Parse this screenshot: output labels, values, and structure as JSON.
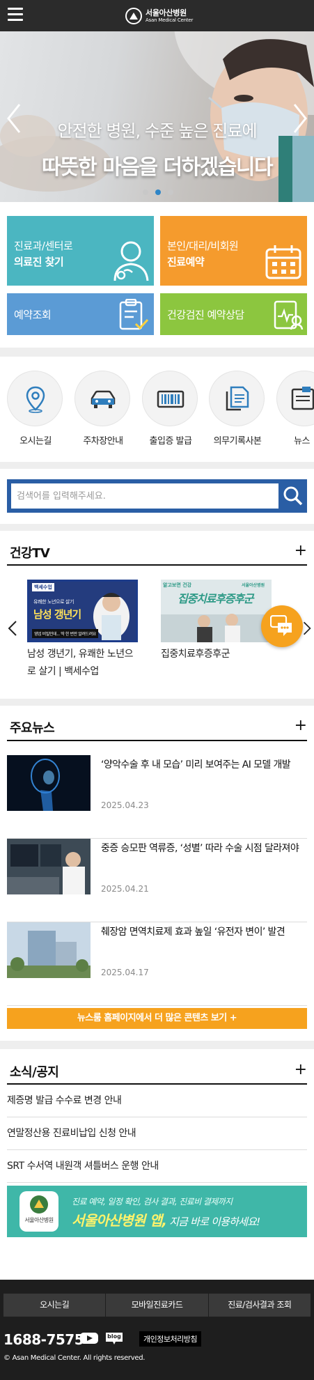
{
  "header": {
    "logo_ko": "서울아산병원",
    "logo_en": "Asan Medical Center"
  },
  "banner": {
    "line1": "안전한 병원, 수준 높은 진료에",
    "line2": "따뜻한 마음을 더하겠습니다",
    "slide_count": 3,
    "active_slide": 2
  },
  "tiles": {
    "find_doctor": {
      "line1": "진료과/센터로",
      "line2": "의료진 찾기",
      "color": "#4bb6c1"
    },
    "reservation": {
      "line1": "본인/대리/비회원",
      "line2": "진료예약",
      "color": "#f59b2d"
    },
    "check_reservation": {
      "label": "예약조회",
      "color": "#5b9bd5"
    },
    "checkup": {
      "label": "건강검진 예약상담",
      "color": "#8cc63f"
    }
  },
  "shortcuts": [
    {
      "label": "오시는길",
      "icon": "map-pin-icon"
    },
    {
      "label": "주차장안내",
      "icon": "car-icon"
    },
    {
      "label": "출입증 발급",
      "icon": "barcode-icon"
    },
    {
      "label": "의무기록사본",
      "icon": "documents-icon"
    },
    {
      "label": "뉴스",
      "icon": "news-icon"
    }
  ],
  "search": {
    "placeholder": "검색어를 입력해주세요."
  },
  "health_tv": {
    "title": "건강TV",
    "plus": "+",
    "items": [
      {
        "caption_line1": "남성 갱년기, 유쾌한 노년으",
        "caption_line2": "로 살기 | 백세수업",
        "thumb_badge": "백세수업",
        "thumb_small": "유쾌한 노년으로 살기",
        "thumb_big": "남성 갱년기",
        "thumb_bottom": "영업 비밀인데... 딱 한 번만 알려드려요"
      },
      {
        "caption_line1": "집중치료후증후군",
        "thumb_title": "집중치료후증후군",
        "thumb_badge": "알고보면 건강",
        "thumb_logo": "서울아산병원"
      }
    ]
  },
  "news": {
    "title": "주요뉴스",
    "plus": "+",
    "items": [
      {
        "title": "‘양악수술 후 내 모습’ 미리 보여주는 AI 모델 개발",
        "date": "2025.04.23"
      },
      {
        "title": "중증 승모판 역류증, ‘성별’ 따라 수술 시점 달라져야",
        "date": "2025.04.21"
      },
      {
        "title": "췌장암 면역치료제 효과 높일 ‘유전자 변이’ 발견",
        "date": "2025.04.17"
      }
    ],
    "more": "뉴스룸 홈페이지에서 더 많은 콘텐츠 보기 +"
  },
  "notices": {
    "title": "소식/공지",
    "plus": "+",
    "items": [
      "제증명 발급 수수료 변경 안내",
      "연말정산용 진료비납입 신청 안내",
      "SRT 수서역 내원객 셔틀버스 운행 안내"
    ]
  },
  "app_banner": {
    "sub": "진료 예약, 일정 확인, 검사 결과, 진료비 결제까지",
    "main_bold": "서울아산병원 앱,",
    "main_rest": " 지금 바로 이용하세요!",
    "logo_text": "서울아산병원"
  },
  "footer": {
    "nav": [
      "오시는길",
      "모바일진료카드",
      "진료/검사결과 조회"
    ],
    "phone": "1688-7575",
    "blog": "blog",
    "privacy": "개인정보처리방침",
    "copyright": "© Asan Medical Center. All rights reserved."
  }
}
